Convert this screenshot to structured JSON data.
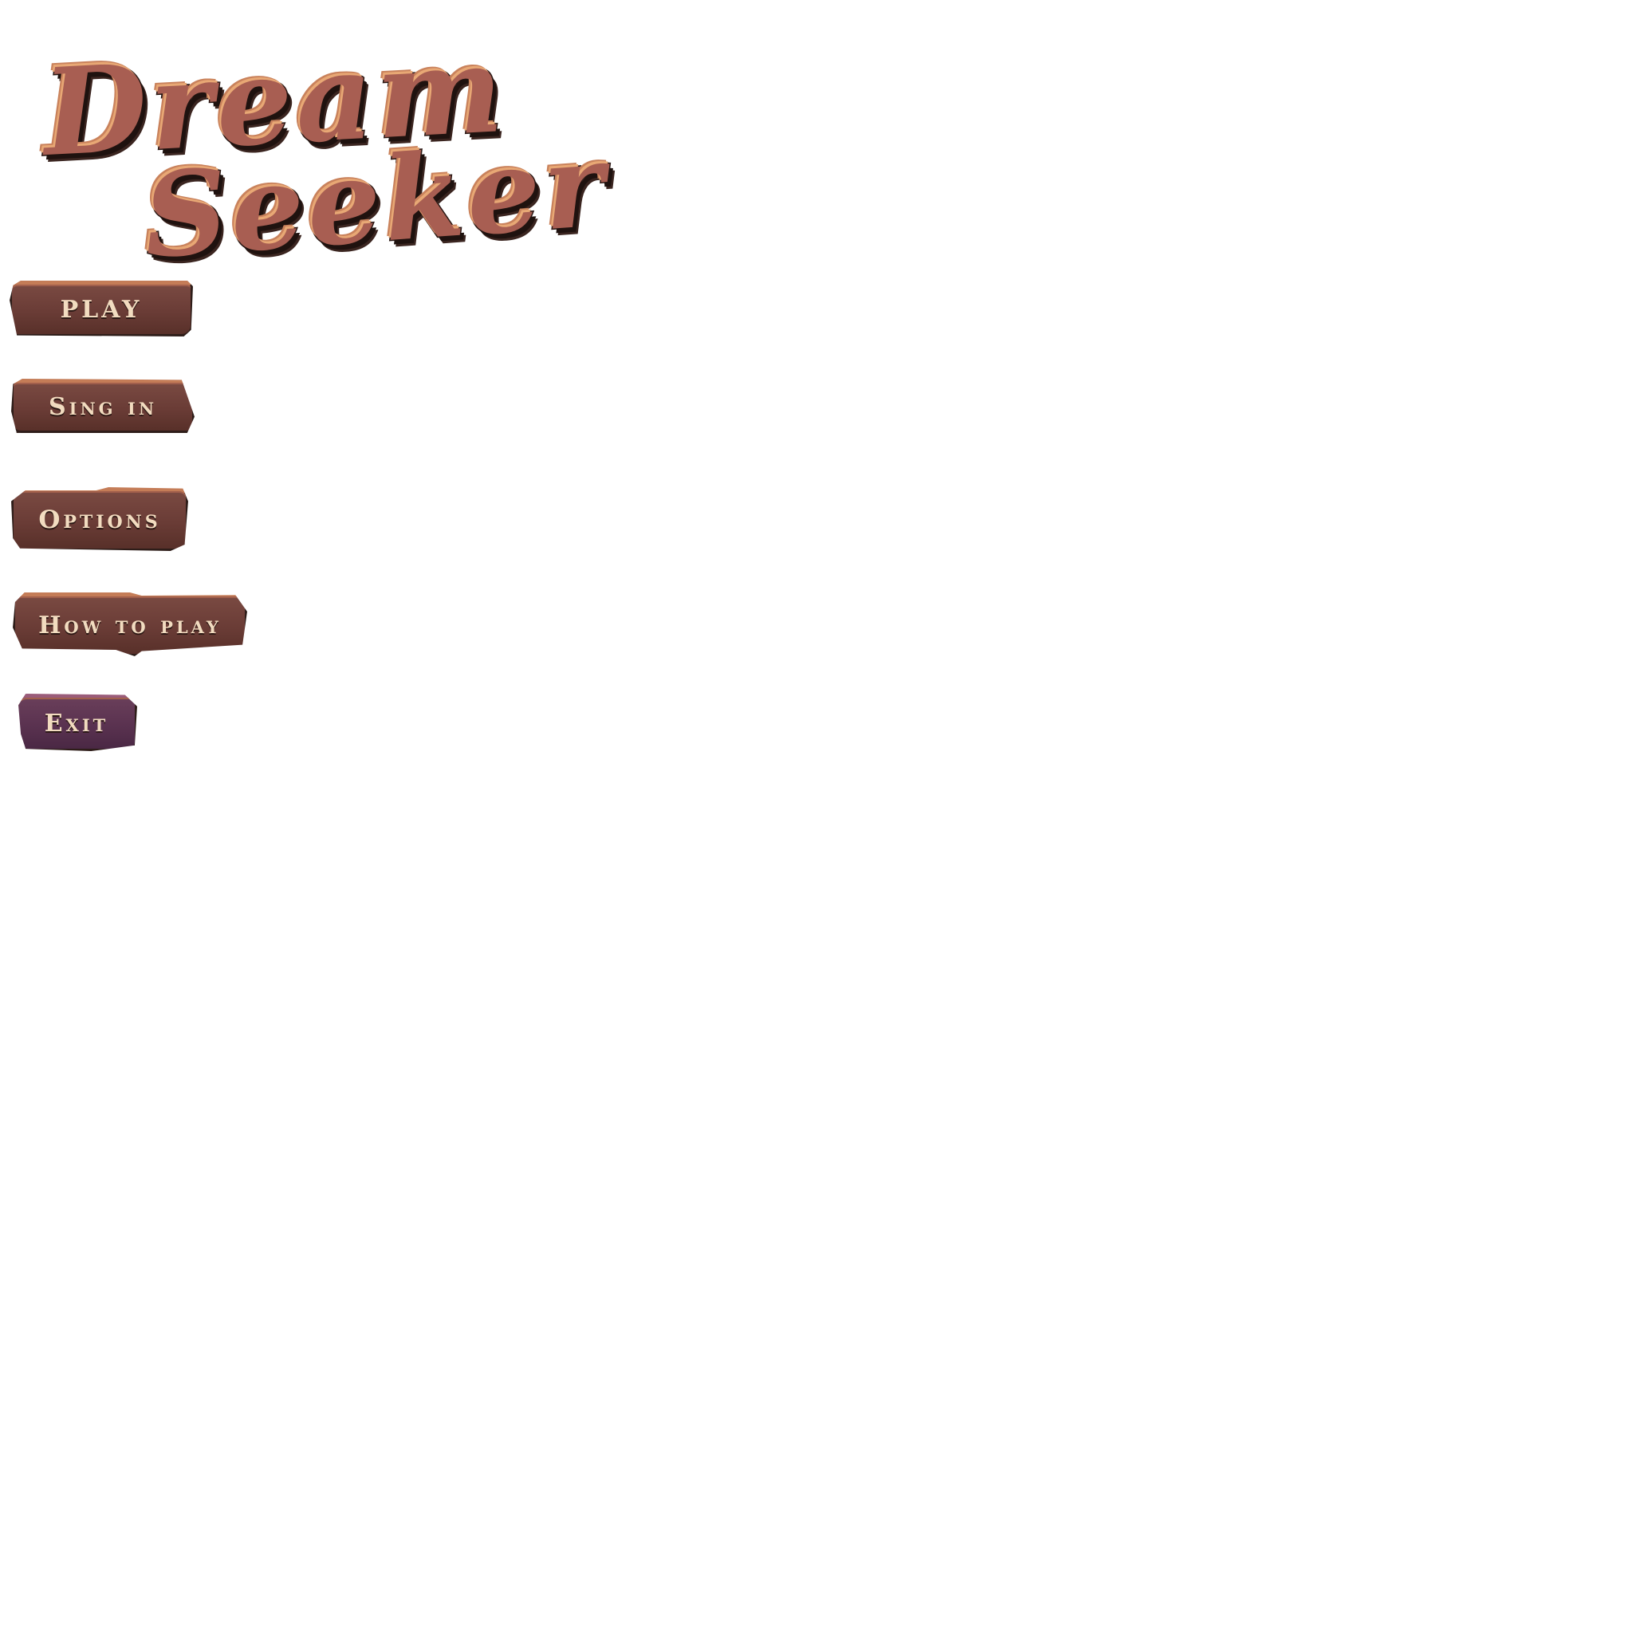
{
  "game": {
    "title_line_1": "Dream",
    "title_line_2": "Seeker"
  },
  "menu": {
    "play_label": "PLAY",
    "signin_label": "Sing in",
    "options_label": "Options",
    "howto_label": "How to play",
    "exit_label": "Exit"
  },
  "colors": {
    "background": "#ffffff",
    "button_wood": "#6a3c36",
    "button_exit": "#5a3250",
    "button_text": "#f2dcc0",
    "logo_fill": "#a85e52"
  }
}
